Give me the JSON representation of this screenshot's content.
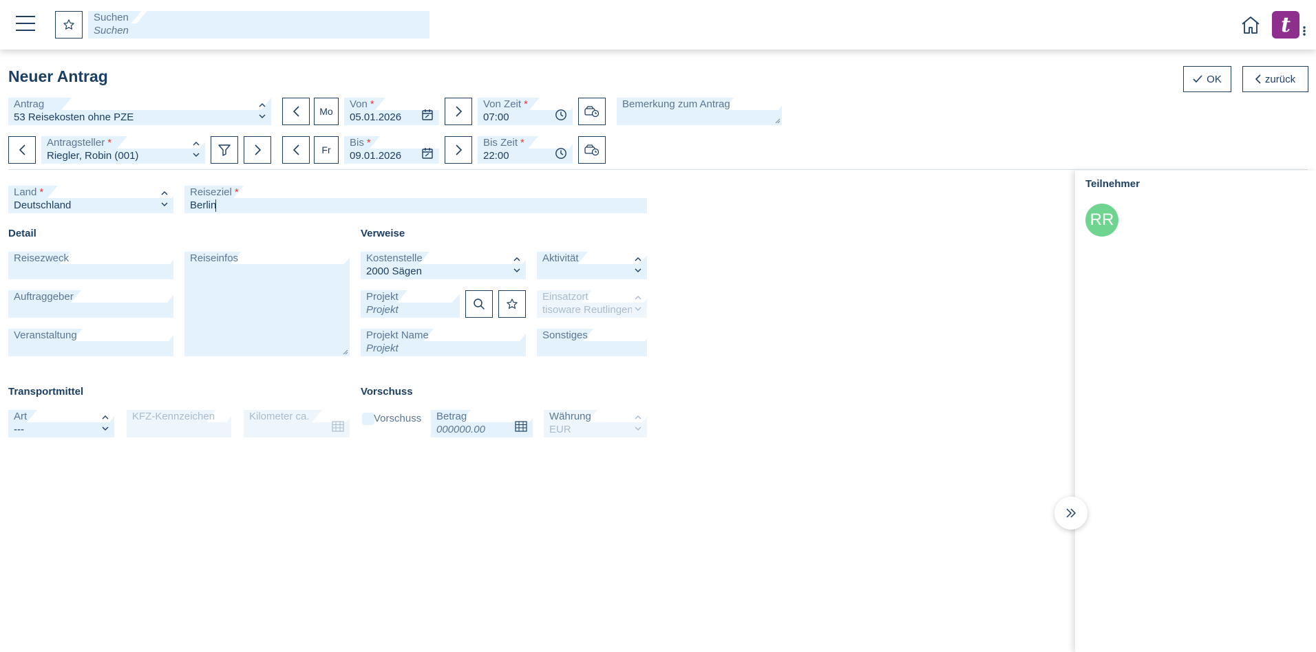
{
  "header": {
    "search_label": "Suchen",
    "search_placeholder": "Suchen",
    "logo_letter": "t"
  },
  "page": {
    "title": "Neuer Antrag",
    "ok_label": "OK",
    "back_label": "zurück"
  },
  "form": {
    "antrag": {
      "label": "Antrag",
      "value": "53 Reisekosten ohne PZE"
    },
    "antragsteller": {
      "label": "Antragsteller",
      "value": "Riegler, Robin (001)"
    },
    "von": {
      "day": "Mo",
      "label": "Von",
      "value": "05.01.2026"
    },
    "bis": {
      "day": "Fr",
      "label": "Bis",
      "value": "09.01.2026"
    },
    "von_zeit": {
      "label": "Von Zeit",
      "value": "07:00"
    },
    "bis_zeit": {
      "label": "Bis Zeit",
      "value": "22:00"
    },
    "bemerkung": {
      "label": "Bemerkung zum Antrag",
      "value": ""
    },
    "land": {
      "label": "Land",
      "value": "Deutschland"
    },
    "reiseziel": {
      "label": "Reiseziel",
      "value": "Berlin"
    }
  },
  "detail": {
    "title": "Detail",
    "reisezweck": {
      "label": "Reisezweck",
      "value": ""
    },
    "reiseinfos": {
      "label": "Reiseinfos",
      "value": ""
    },
    "auftraggeber": {
      "label": "Auftraggeber",
      "value": ""
    },
    "veranstaltung": {
      "label": "Veranstaltung",
      "value": ""
    }
  },
  "verweise": {
    "title": "Verweise",
    "kostenstelle": {
      "label": "Kostenstelle",
      "value": "2000 Sägen"
    },
    "aktivitaet": {
      "label": "Aktivität",
      "value": ""
    },
    "projekt": {
      "label": "Projekt",
      "placeholder": "Projekt"
    },
    "einsatzort": {
      "label": "Einsatzort",
      "value": "tisoware Reutlingen"
    },
    "projekt_name": {
      "label": "Projekt Name",
      "placeholder": "Projekt"
    },
    "sonstiges": {
      "label": "Sonstiges",
      "value": ""
    }
  },
  "transport": {
    "title": "Transportmittel",
    "art": {
      "label": "Art",
      "value": "---"
    },
    "kfz": {
      "label": "KFZ-Kennzeichen",
      "value": ""
    },
    "kilometer": {
      "label": "Kilometer ca.",
      "value": ""
    }
  },
  "vorschuss": {
    "title": "Vorschuss",
    "checkbox_label": "Vorschuss",
    "betrag": {
      "label": "Betrag",
      "placeholder": "000000.00"
    },
    "waehrung": {
      "label": "Währung",
      "value": "EUR"
    }
  },
  "side": {
    "title": "Teilnehmer",
    "avatar_initials": "RR"
  },
  "colors": {
    "primary": "#1c3f63",
    "field_bg": "#e3f2fc",
    "required": "#e03c31",
    "avatar": "#6fd48f",
    "logo": "#8e2f8e"
  }
}
